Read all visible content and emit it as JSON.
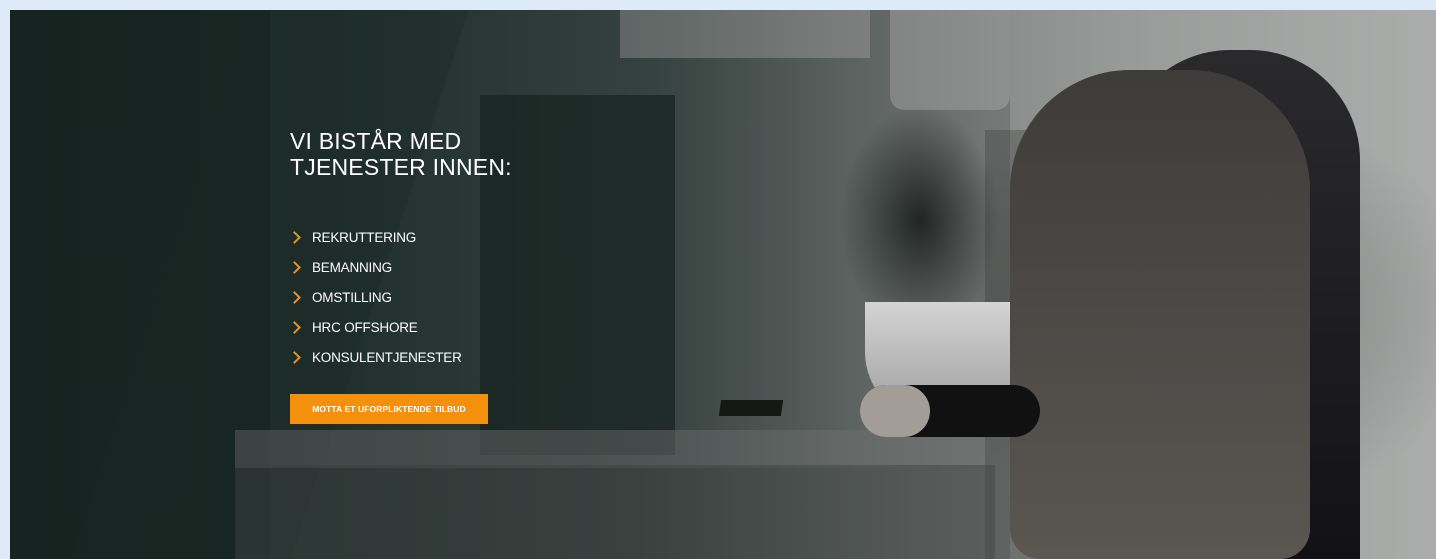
{
  "hero": {
    "heading_line1": "VI BISTÅR MED",
    "heading_line2": "TJENESTER INNEN:",
    "services": [
      {
        "label": "REKRUTTERING"
      },
      {
        "label": "BEMANNING"
      },
      {
        "label": "OMSTILLING"
      },
      {
        "label": "HRC OFFSHORE"
      },
      {
        "label": "KONSULENTJENESTER"
      }
    ],
    "cta_label": "MOTTA ET UFORPLIKTENDE TILBUD"
  },
  "colors": {
    "accent": "#f5900d",
    "page_border": "#dcebf7",
    "text": "#ffffff"
  },
  "icons": {
    "bullet": "chevron-right-icon"
  }
}
